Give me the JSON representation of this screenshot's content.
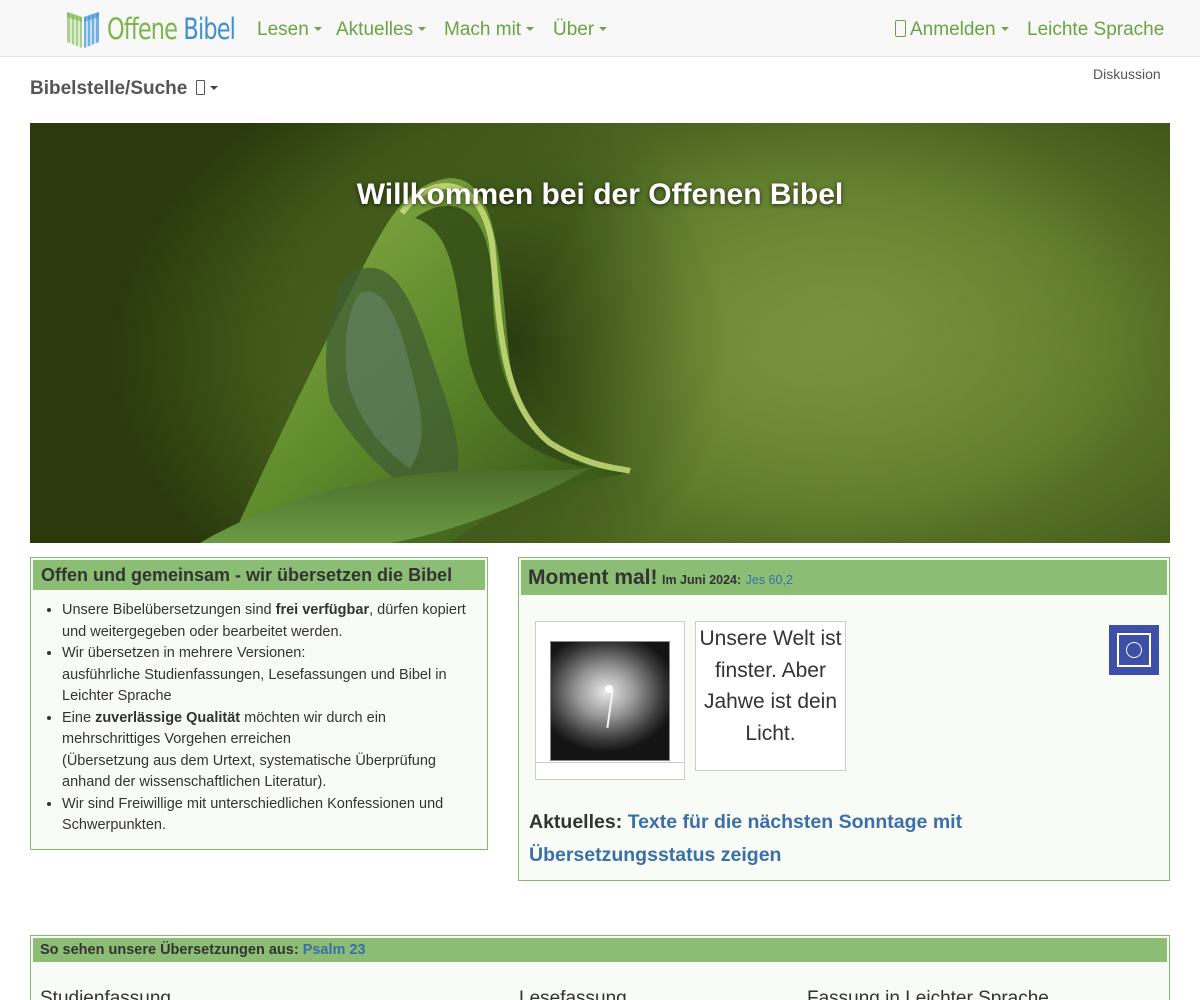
{
  "header": {
    "logo": {
      "word1": "Offene",
      "word2": "Bibel",
      "icon": "book-logo-icon",
      "colors": {
        "green": "#7ab648",
        "blue": "#3f8fd1"
      }
    },
    "nav": [
      {
        "label": "Lesen",
        "dropdown": true
      },
      {
        "label": "Aktuelles",
        "dropdown": true
      },
      {
        "label": "Mach mit",
        "dropdown": true
      },
      {
        "label": "Über",
        "dropdown": true
      }
    ],
    "login": {
      "icon": "user-icon",
      "label": "Anmelden",
      "dropdown": true
    },
    "easy_language": "Leichte Sprache"
  },
  "subheader": {
    "search_label": "Bibelstelle/Suche",
    "search_icon": "search-icon",
    "discussion": "Diskussion"
  },
  "hero": {
    "title": "Willkommen bei der Offenen Bibel",
    "image": "green-leaf-photo"
  },
  "intro_box": {
    "heading": "Offen und gemeinsam - wir übersetzen die Bibel",
    "items": [
      {
        "pre": "Unsere Bibelübersetzungen sind ",
        "bold": "frei verfügbar",
        "post": ", dürfen kopiert und weitergegeben oder bearbeitet werden."
      },
      {
        "pre": "Wir übersetzen in mehrere Versionen:",
        "line2": "ausführliche Studienfassungen, Lesefassungen und Bibel in Leichter Sprache"
      },
      {
        "pre": "Eine ",
        "bold": "zuverlässige Qualität",
        "post": " möchten wir durch ein mehrschrittiges Vorgehen erreichen",
        "line2": "(Übersetzung aus dem Urtext, systematische Überprüfung anhand der wissenschaftlichen Literatur)."
      },
      {
        "pre": "Wir sind Freiwillige mit unterschiedlichen Konfessionen und Schwerpunkten."
      }
    ]
  },
  "moment_box": {
    "title": "Moment mal!",
    "month": "Im Juni 2024:",
    "ref": "Jes 60,2",
    "quote": "Unsere Welt ist finster. Aber Jahwe ist dein Licht.",
    "photo": "dark-lightbulb-photo",
    "badge_icon": "open-bible-badge-icon",
    "news_label": "Aktuelles:",
    "news_link": "Texte für die nächsten Sonntage mit Übersetzungsstatus zeigen"
  },
  "sample_box": {
    "heading": "So sehen unsere Übersetzungen aus:",
    "link": "Psalm 23",
    "columns": [
      "Studienfassung",
      "Lesefassung",
      "Fassung in Leichter Sprache"
    ]
  },
  "colors": {
    "nav_green": "#6aa343",
    "box_border": "#7cbe6a",
    "box_header": "#8bbd74",
    "link_blue": "#3a6fa8",
    "badge_blue": "#3e4fa8"
  }
}
